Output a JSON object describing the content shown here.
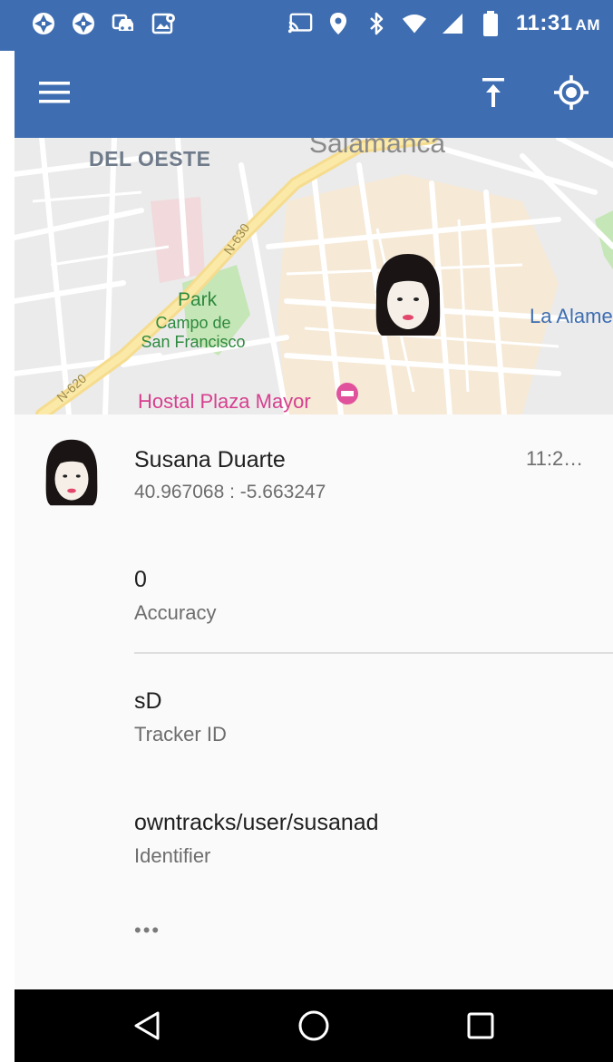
{
  "status_bar": {
    "left_icons": [
      "aperture-icon",
      "aperture-icon",
      "car-icon",
      "location-photo-icon"
    ],
    "right_icons": [
      "cast-icon",
      "location-pin-icon",
      "bluetooth-icon",
      "wifi-icon",
      "signal-icon",
      "battery-icon"
    ],
    "time": "11:31",
    "ampm": "AM"
  },
  "app_bar": {
    "menu_icon": "menu-icon",
    "actions": [
      "upload-top-icon",
      "my-location-icon"
    ],
    "background": "#3e6eb1"
  },
  "map": {
    "district_label": "DEL OESTE",
    "city_label": "Salamanca",
    "park_title": "Park",
    "park_name": "Campo de San Francisco",
    "street_label": "La Alame",
    "poi_label": "Hostal Plaza Mayor",
    "road_label_1": "N-620",
    "road_label_2": "N-630"
  },
  "contact": {
    "name": "Susana Duarte",
    "coordinates": "40.967068 : -5.663247",
    "time": "11:2…"
  },
  "details": [
    {
      "value": "0",
      "label": "Accuracy"
    },
    {
      "value": "sD",
      "label": "Tracker ID"
    },
    {
      "value": "owntracks/user/susanad",
      "label": "Identifier"
    }
  ],
  "more": "•••",
  "nav_bar": [
    "back-icon",
    "home-icon",
    "recents-icon"
  ]
}
